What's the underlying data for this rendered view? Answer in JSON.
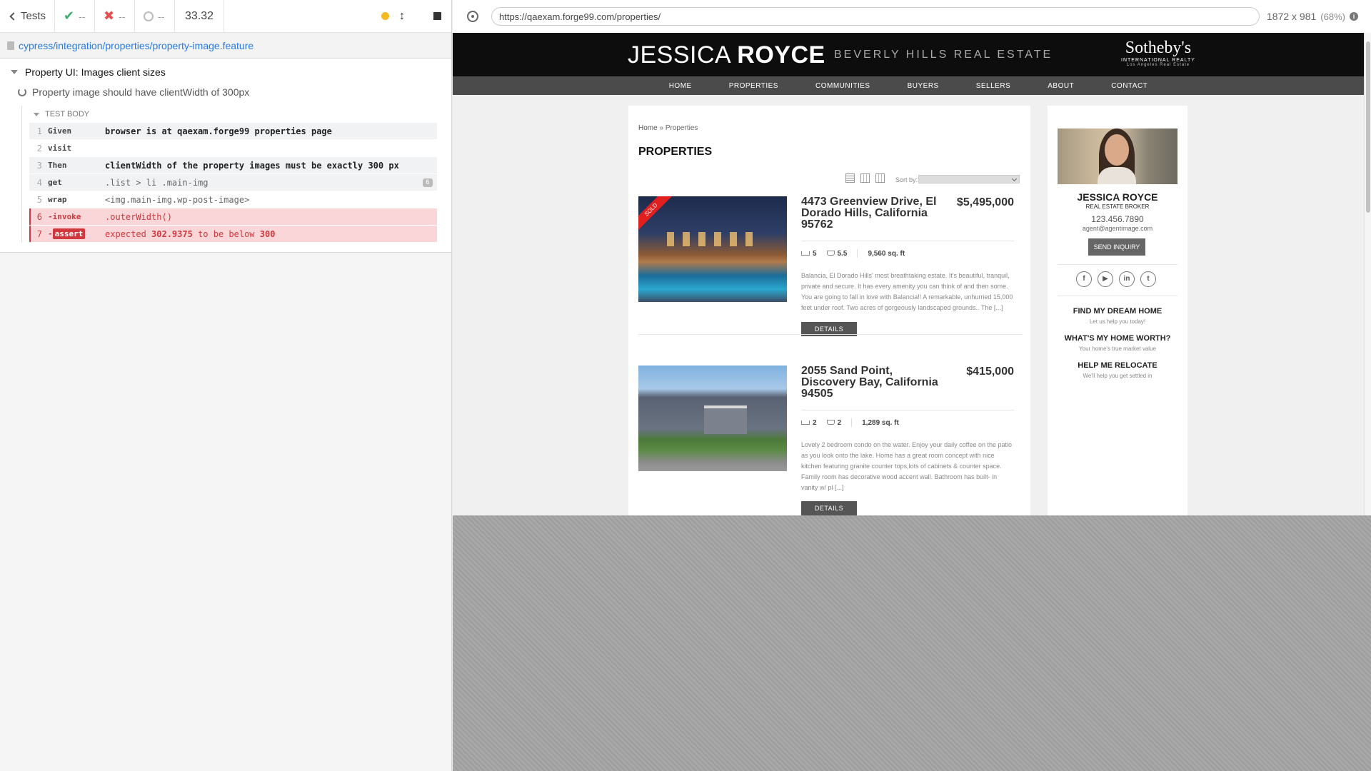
{
  "reporter": {
    "tests_label": "Tests",
    "passed": "--",
    "failed": "--",
    "pending": "--",
    "duration": "33.32",
    "spec_path": "cypress/integration/properties/property-image.feature",
    "suite_title": "Property UI: Images client sizes",
    "test_title": "Property image should have clientWidth of 300px",
    "body_label": "TEST BODY",
    "commands": [
      {
        "num": "1",
        "name": "Given",
        "msg": "browser is at qaexam.forge99 properties page"
      },
      {
        "num": "2",
        "name": "visit",
        "msg": ""
      },
      {
        "num": "3",
        "name": "Then",
        "msg": "clientWidth of the property images must be exactly 300 px"
      },
      {
        "num": "4",
        "name": "get",
        "msg": ".list > li .main-img",
        "count": "6"
      },
      {
        "num": "5",
        "name": "wrap",
        "msg": "<img.main-img.wp-post-image>"
      },
      {
        "num": "6",
        "name": "-invoke",
        "msg": ".outerWidth()"
      },
      {
        "num": "7",
        "name": "-",
        "tag": "assert",
        "msg_pre": "expected",
        "msg_val1": "302.9375",
        "msg_mid": "to be below",
        "msg_val2": "300"
      }
    ]
  },
  "aut": {
    "url": "https://qaexam.forge99.com/properties/",
    "viewport": "1872 x 981",
    "zoom": "(68%)",
    "site": {
      "logo_first": "JESSICA ",
      "logo_last": "ROYCE",
      "tagline": "BEVERLY HILLS REAL ESTATE",
      "brand_big": "Sotheby's",
      "brand_small": "INTERNATIONAL REALTY",
      "brand_tiny": "Los Angeles Real Estate",
      "nav": [
        "HOME",
        "PROPERTIES",
        "COMMUNITIES",
        "BUYERS",
        "SELLERS",
        "ABOUT",
        "CONTACT"
      ],
      "breadcrumb_home": "Home",
      "breadcrumb_sep": " » ",
      "breadcrumb_current": "Properties",
      "page_title": "PROPERTIES",
      "sort_label": "Sort by:",
      "listings": [
        {
          "badge": "SOLD",
          "address": "4473 Greenview Drive, El Dorado Hills, California 95762",
          "price": "$5,495,000",
          "beds": "5",
          "baths": "5.5",
          "sqft": "9,560 sq. ft",
          "description": "Balancia, El Dorado Hills' most breathtaking estate. It's beautiful, tranquil, private and secure. It has every amenity you can think of and then some. You are going to fall in love with Balancia!! A remarkable, unhurried 15,000 feet under roof. Two acres of gorgeously landscaped grounds.. The [...]",
          "button": "DETAILS"
        },
        {
          "badge": "",
          "address": "2055 Sand Point, Discovery Bay, California 94505",
          "price": "$415,000",
          "beds": "2",
          "baths": "2",
          "sqft": "1,289 sq. ft",
          "description": "Lovely 2 bedroom condo on the water. Enjoy your daily coffee on the patio as you look onto the lake. Home has a great room concept with nice kitchen featuring granite counter tops,lots of cabinets & counter space. Family room has decorative wood accent wall. Bathroom has built- in vanity w/ pl [...]",
          "button": "DETAILS"
        }
      ],
      "agent": {
        "name": "JESSICA ROYCE",
        "title": "REAL ESTATE BROKER",
        "phone": "123.456.7890",
        "email": "agent@agentimage.com",
        "button": "SEND INQUIRY",
        "social": [
          "f",
          "▶",
          "in",
          "t"
        ],
        "ctas": [
          {
            "title": "FIND MY DREAM HOME",
            "sub": "Let us help you today!"
          },
          {
            "title": "WHAT'S MY HOME WORTH?",
            "sub": "Your home's true market value"
          },
          {
            "title": "HELP ME RELOCATE",
            "sub": "We'll help you get settled in"
          }
        ]
      }
    }
  }
}
